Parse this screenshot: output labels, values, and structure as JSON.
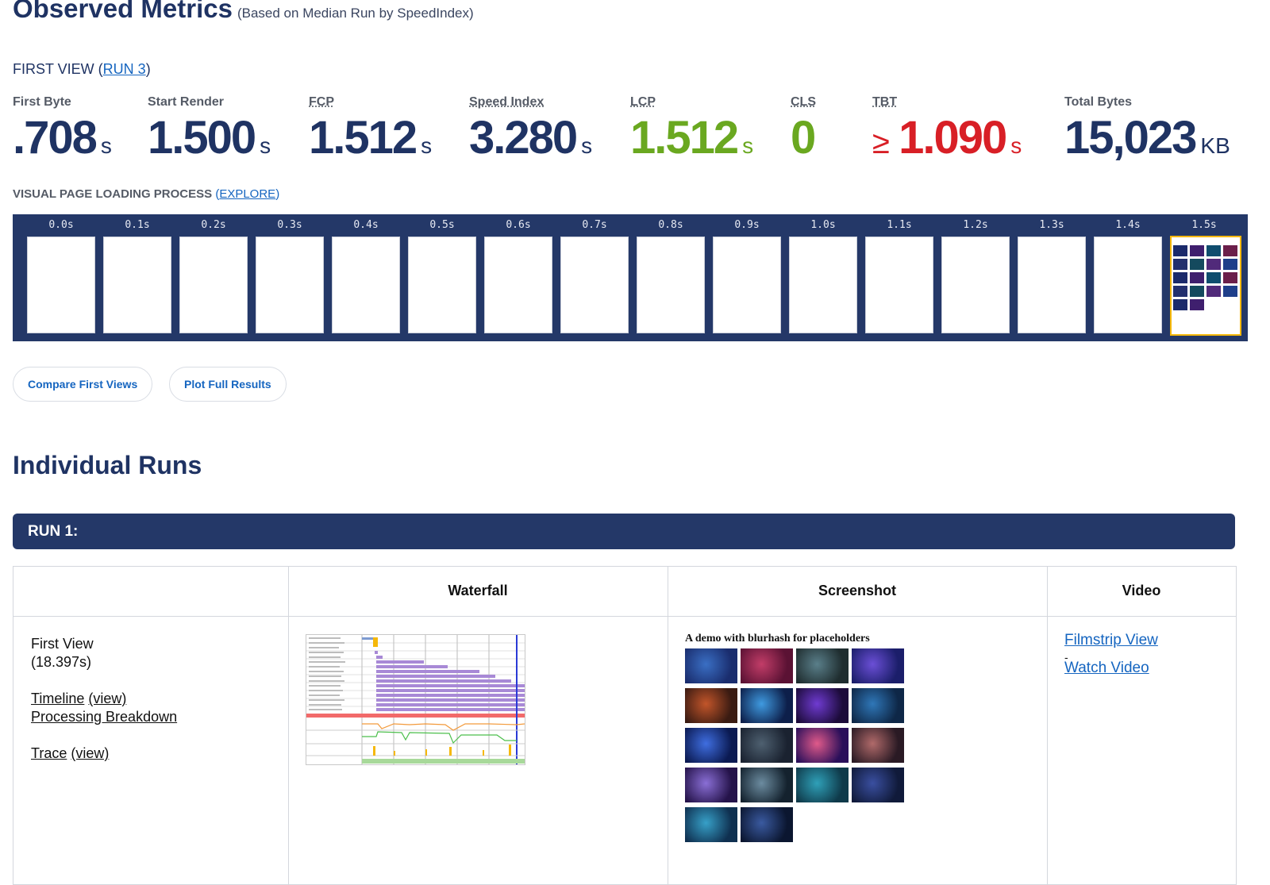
{
  "header": {
    "title": "Observed Metrics",
    "subtitle": "(Based on Median Run by SpeedIndex)"
  },
  "first_view": {
    "label_prefix": "FIRST VIEW (",
    "run_link": "RUN 3",
    "label_suffix": ")"
  },
  "metrics": [
    {
      "label": "First Byte",
      "value": ".708",
      "unit": "s",
      "color": "#1f3363",
      "prefix": ""
    },
    {
      "label": "Start Render",
      "value": "1.500",
      "unit": "s",
      "color": "#1f3363",
      "prefix": ""
    },
    {
      "label": "FCP",
      "value": "1.512",
      "unit": "s",
      "color": "#1f3363",
      "prefix": ""
    },
    {
      "label": "Speed Index",
      "value": "3.280",
      "unit": "s",
      "color": "#1f3363",
      "prefix": ""
    },
    {
      "label": "LCP",
      "value": "1.512",
      "unit": "s",
      "color": "#6aa820",
      "prefix": ""
    },
    {
      "label": "CLS",
      "value": "0",
      "unit": "",
      "color": "#6aa820",
      "prefix": ""
    },
    {
      "label": "TBT",
      "value": "1.090",
      "unit": "s",
      "color": "#d81f26",
      "prefix": "≥ "
    },
    {
      "label": "Total Bytes",
      "value": "15,023",
      "unit": "KB",
      "color": "#1f3363",
      "prefix": ""
    }
  ],
  "visual_loading": {
    "label": "VISUAL PAGE LOADING PROCESS",
    "explore_link": "EXPLORE",
    "frames": [
      "0.0s",
      "0.1s",
      "0.2s",
      "0.3s",
      "0.4s",
      "0.5s",
      "0.6s",
      "0.7s",
      "0.8s",
      "0.9s",
      "1.0s",
      "1.1s",
      "1.2s",
      "1.3s",
      "1.4s",
      "1.5s"
    ]
  },
  "buttons": {
    "compare": "Compare First Views",
    "plot": "Plot Full Results"
  },
  "individual_runs": {
    "title": "Individual Runs",
    "run_label": "RUN 1:",
    "columns": [
      "Waterfall",
      "Screenshot",
      "Video"
    ],
    "first_view": {
      "name": "First View",
      "time": "(18.397s)",
      "timeline": "Timeline",
      "view": "(view)",
      "processing": "Processing Breakdown",
      "trace": "Trace",
      "trace_view": "(view)"
    },
    "screenshot_title": "A demo with blurhash for placeholders",
    "video": {
      "filmstrip": "Filmstrip View",
      "separator": "-",
      "watch": "Watch Video"
    }
  },
  "colors": {
    "navy": "#243868",
    "link": "#1565c0",
    "good": "#6aa820",
    "bad": "#d81f26"
  }
}
